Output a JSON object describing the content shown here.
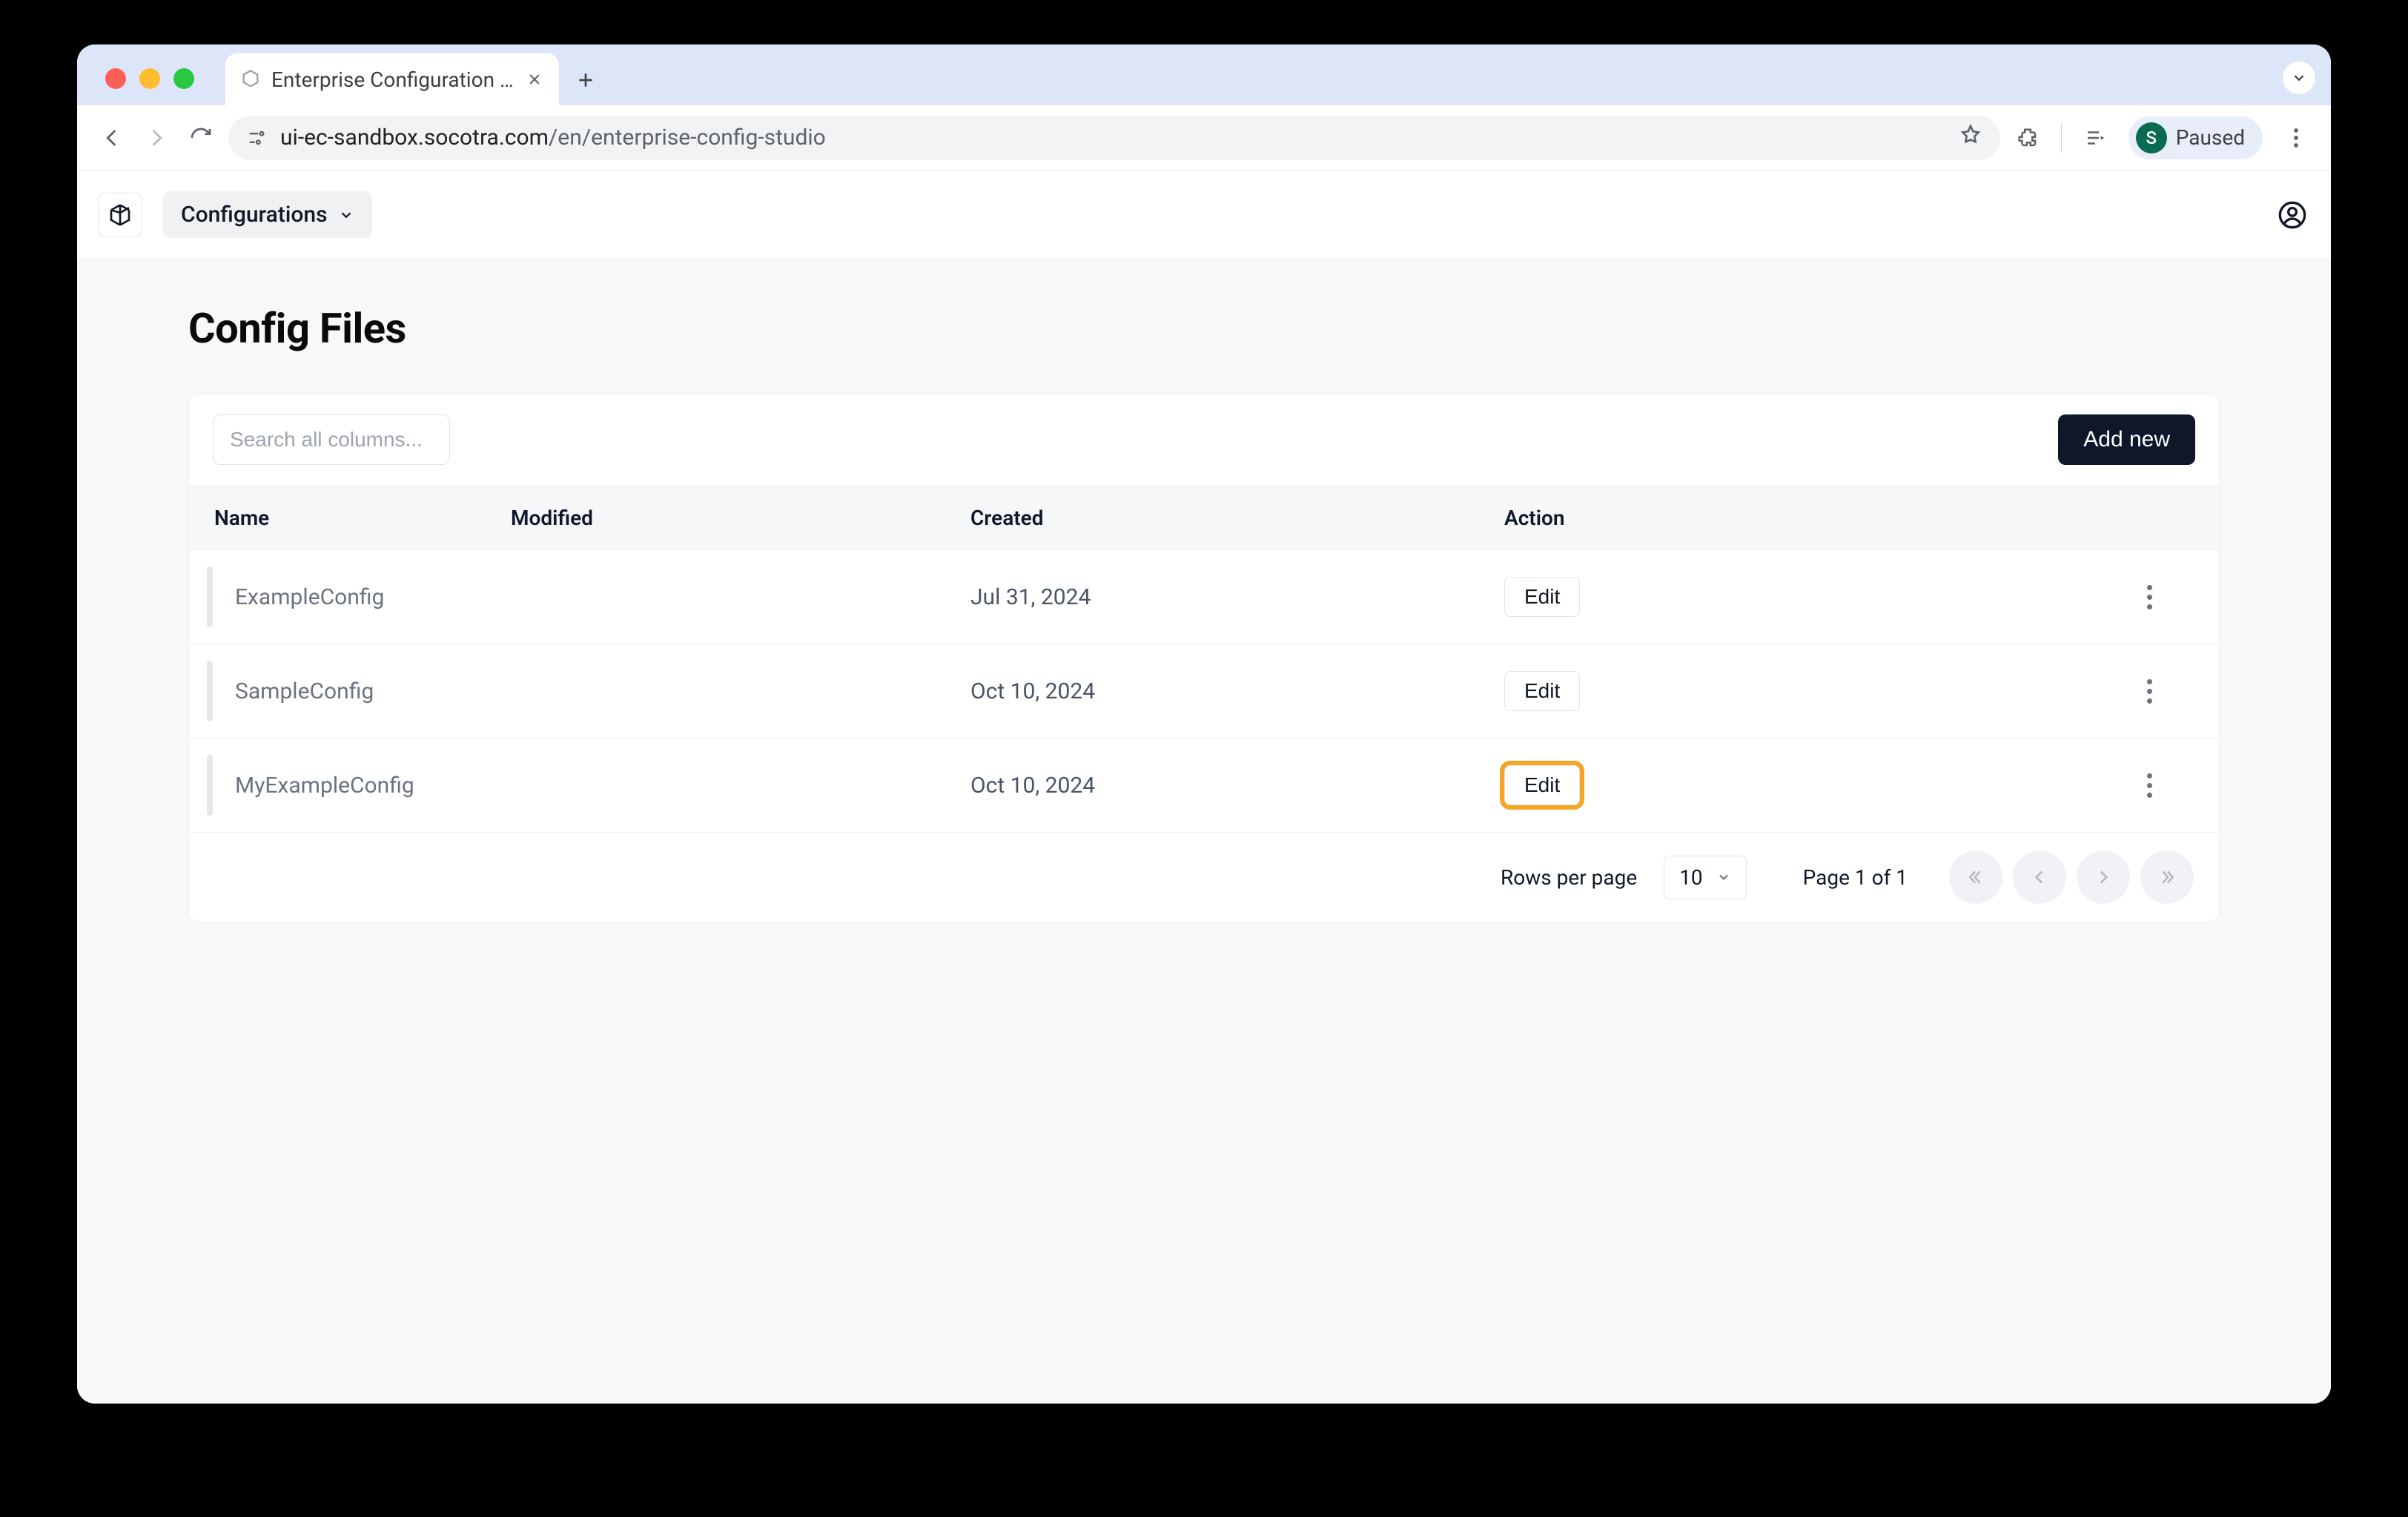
{
  "browser": {
    "tab_title": "Enterprise Configuration Stud…",
    "url_host": "ui-ec-sandbox.socotra.com",
    "url_path": "/en/enterprise-config-studio",
    "paused_label": "Paused",
    "avatar_initial": "S"
  },
  "app": {
    "menu_label": "Configurations"
  },
  "page": {
    "title": "Config Files",
    "search_placeholder": "Search all columns...",
    "add_new_label": "Add new",
    "columns": {
      "name": "Name",
      "modified": "Modified",
      "created": "Created",
      "action": "Action"
    },
    "rows": [
      {
        "name": "ExampleConfig",
        "modified": "",
        "created": "Jul 31, 2024",
        "action_label": "Edit",
        "highlight": false
      },
      {
        "name": "SampleConfig",
        "modified": "",
        "created": "Oct 10, 2024",
        "action_label": "Edit",
        "highlight": false
      },
      {
        "name": "MyExampleConfig",
        "modified": "",
        "created": "Oct 10, 2024",
        "action_label": "Edit",
        "highlight": true
      }
    ],
    "pagination": {
      "rows_per_page_label": "Rows per page",
      "rows_per_page_value": "10",
      "page_info": "Page 1 of 1"
    }
  }
}
